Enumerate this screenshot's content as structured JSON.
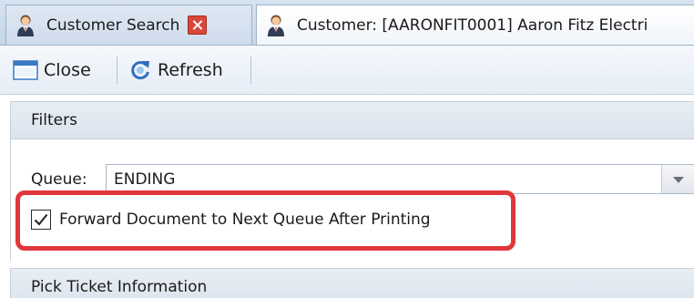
{
  "tabs": [
    {
      "label": "Customer Search",
      "icon": "customer-icon",
      "closable": true
    },
    {
      "label": "Customer: [AARONFIT0001] Aaron Fitz Electri",
      "icon": "customer-icon",
      "closable": false
    }
  ],
  "toolbar": {
    "close_label": "Close",
    "close_icon": "window-icon",
    "refresh_label": "Refresh",
    "refresh_icon": "refresh-icon"
  },
  "filters": {
    "title": "Filters",
    "queue": {
      "label": "Queue:",
      "value": "ENDING"
    },
    "forward_document": {
      "label": "Forward Document to Next Queue After Printing",
      "checked": true
    }
  },
  "pick_ticket": {
    "title": "Pick Ticket Information"
  },
  "colors": {
    "highlight": "#e0373c",
    "tab_close": "#d9473a"
  }
}
